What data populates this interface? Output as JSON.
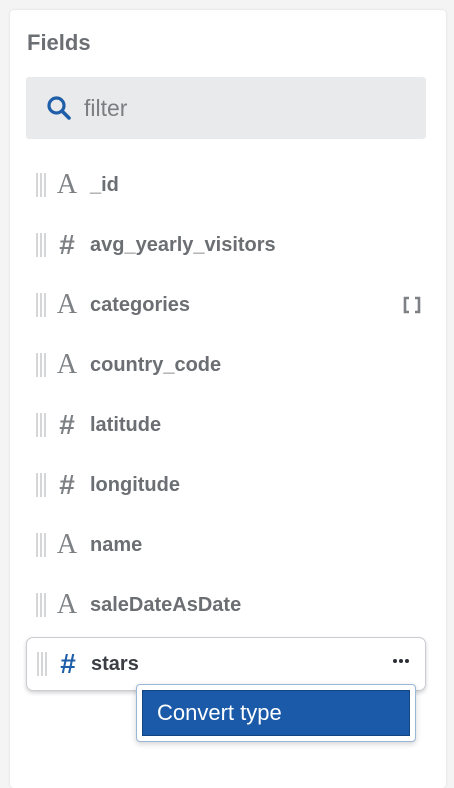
{
  "panel": {
    "title": "Fields"
  },
  "search": {
    "placeholder": "filter",
    "value": "",
    "icon": "search-icon",
    "icon_color": "#1f5fa9"
  },
  "fields": [
    {
      "name": "_id",
      "type": "string",
      "type_icon": "A"
    },
    {
      "name": "avg_yearly_visitors",
      "type": "number",
      "type_icon": "#"
    },
    {
      "name": "categories",
      "type": "string",
      "type_icon": "A",
      "is_array": true
    },
    {
      "name": "country_code",
      "type": "string",
      "type_icon": "A"
    },
    {
      "name": "latitude",
      "type": "number",
      "type_icon": "#"
    },
    {
      "name": "longitude",
      "type": "number",
      "type_icon": "#"
    },
    {
      "name": "name",
      "type": "string",
      "type_icon": "A"
    },
    {
      "name": "saleDateAsDate",
      "type": "string",
      "type_icon": "A"
    },
    {
      "name": "stars",
      "type": "number",
      "type_icon": "#",
      "active": true
    }
  ],
  "context_menu": {
    "items": [
      {
        "label": "Convert type",
        "highlighted": true
      }
    ]
  },
  "colors": {
    "accent": "#1a5aa8",
    "text": "#6b6e72",
    "search_bg": "#e9eaeb"
  }
}
